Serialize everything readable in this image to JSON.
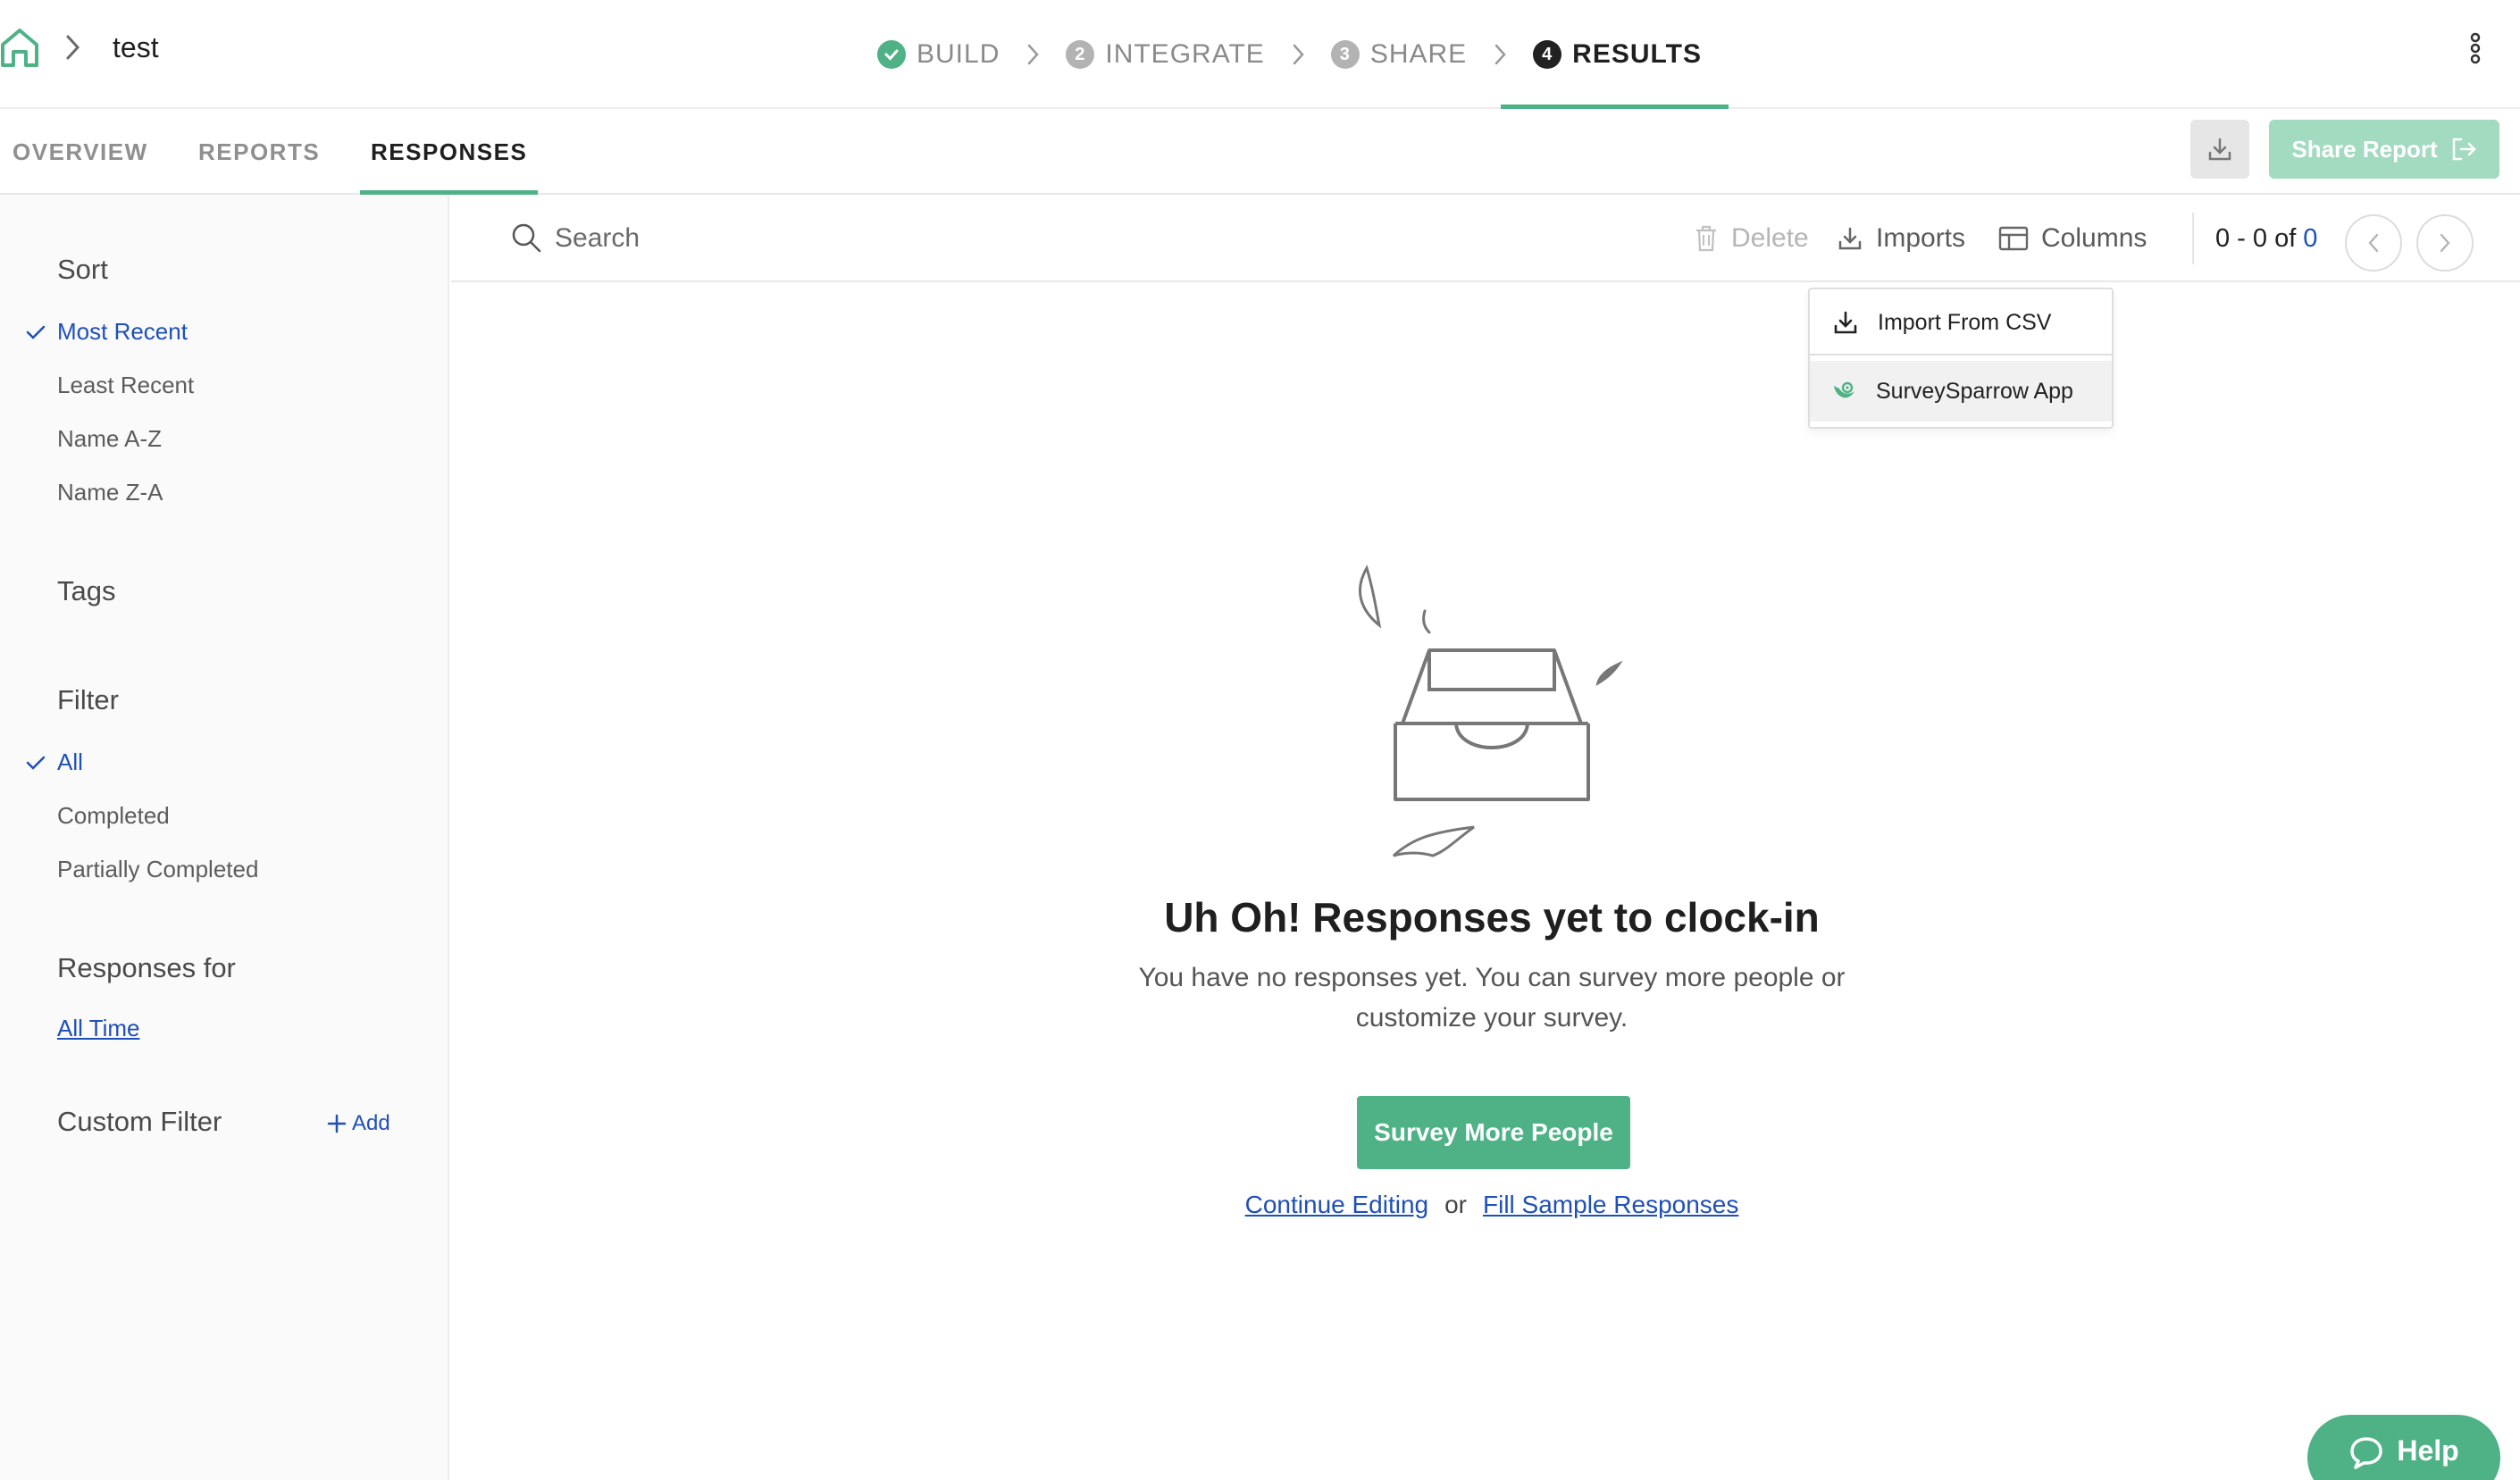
{
  "header": {
    "breadcrumb_title": "test",
    "steps": [
      {
        "num": "✓",
        "label": "BUILD",
        "state": "done"
      },
      {
        "num": "2",
        "label": "INTEGRATE",
        "state": "pending"
      },
      {
        "num": "3",
        "label": "SHARE",
        "state": "pending"
      },
      {
        "num": "4",
        "label": "RESULTS",
        "state": "active"
      }
    ]
  },
  "tabs": [
    {
      "label": "OVERVIEW",
      "active": false
    },
    {
      "label": "REPORTS",
      "active": false
    },
    {
      "label": "RESPONSES",
      "active": true
    }
  ],
  "actions": {
    "share_report_label": "Share Report"
  },
  "sidebar": {
    "sort_heading": "Sort",
    "sort_options": [
      {
        "label": "Most Recent",
        "selected": true
      },
      {
        "label": "Least Recent",
        "selected": false
      },
      {
        "label": "Name A-Z",
        "selected": false
      },
      {
        "label": "Name Z-A",
        "selected": false
      }
    ],
    "tags_heading": "Tags",
    "filter_heading": "Filter",
    "filter_options": [
      {
        "label": "All",
        "selected": true
      },
      {
        "label": "Completed",
        "selected": false
      },
      {
        "label": "Partially Completed",
        "selected": false
      }
    ],
    "responses_for_heading": "Responses for",
    "responses_for_value": "All Time",
    "custom_filter_heading": "Custom Filter",
    "add_label": "Add"
  },
  "toolbar": {
    "search_placeholder": "Search",
    "delete_label": "Delete",
    "imports_label": "Imports",
    "columns_label": "Columns",
    "pager_range": "0 - 0 of",
    "pager_total": "0"
  },
  "imports_menu": {
    "items": [
      {
        "label": "Import From CSV",
        "icon": "download-icon"
      },
      {
        "label": "SurveySparrow App",
        "icon": "surveysparrow-logo-icon"
      }
    ]
  },
  "empty_state": {
    "title": "Uh Oh! Responses yet to clock-in",
    "description": "You have no responses yet. You can survey more people or customize your survey.",
    "cta_label": "Survey More People",
    "continue_editing_label": "Continue Editing",
    "or_label": "or",
    "fill_sample_label": "Fill Sample Responses"
  },
  "help": {
    "label": "Help"
  },
  "colors": {
    "accent_green": "#4fb286",
    "link_blue": "#1f4fb8",
    "disabled_green": "#a3dbc1"
  }
}
